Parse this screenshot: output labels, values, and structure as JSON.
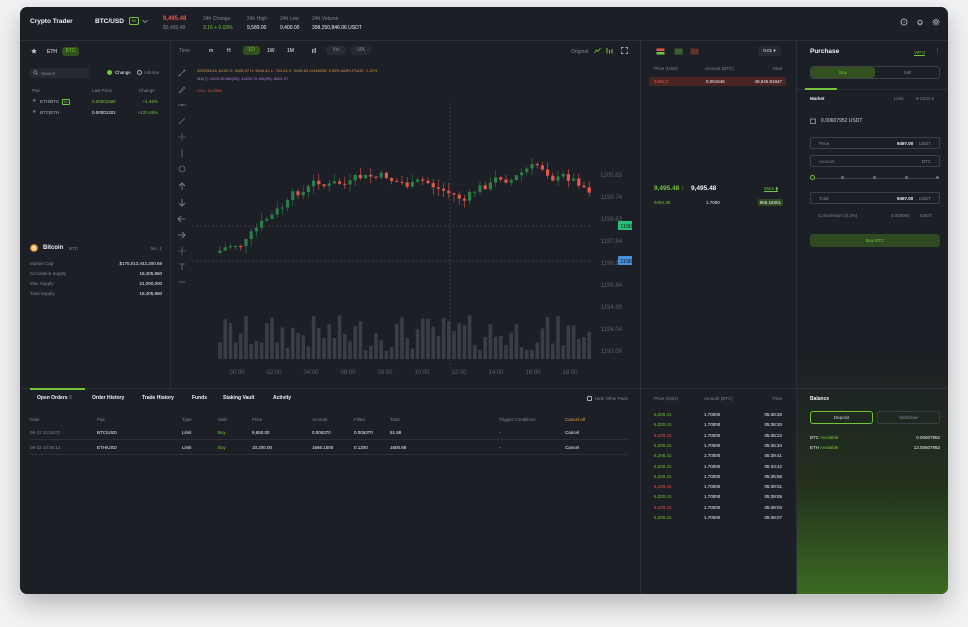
{
  "header": {
    "app_title": "Crypto Trader",
    "pair": "BTC/USD",
    "pair_badge": "5x",
    "last_price": "9,495.48",
    "last_price_usd": "$9,495.48",
    "stats": [
      {
        "label": "24h Change",
        "value": "3.16 + 0.03%"
      },
      {
        "label": "24h High",
        "value": "9,589.00"
      },
      {
        "label": "24h Low",
        "value": "9,400.00"
      },
      {
        "label": "24h Volume",
        "value": "398,250,846.06 USDT"
      }
    ]
  },
  "markets": {
    "tabs": [
      "ETH",
      "BTC"
    ],
    "search_placeholder": "Search",
    "toggle_change": "Change",
    "toggle_volume": "Volume",
    "columns": [
      "Pair",
      "Last Price",
      "Change"
    ],
    "rows": [
      {
        "pair": "ETH/BTC",
        "badge": "5x",
        "price": "0.00001586",
        "change": "+1.46%"
      },
      {
        "pair": "BTC/ETH",
        "badge": "",
        "price": "0.00001301",
        "change": "+120.45%"
      }
    ]
  },
  "coin": {
    "name": "Bitcoin",
    "ticker": "BTC",
    "rank": "No. 1",
    "info": [
      {
        "label": "Market Cap",
        "value": "$175,013,442,200.69"
      },
      {
        "label": "Circulation Supply",
        "value": "18,405,860"
      },
      {
        "label": "Max Supply",
        "value": "21,000,000"
      },
      {
        "label": "Total Supply",
        "value": "18,405,860"
      }
    ]
  },
  "chart": {
    "time_label": "Time",
    "intervals": [
      "m",
      "H",
      "1D",
      "1W",
      "1M"
    ],
    "active_interval": "1D",
    "indicators": [
      "Vol",
      "MA"
    ],
    "view_mode": "Original",
    "ohlc_line": "2020/06/16 18:00 O: 9425.97 H: 9534.42 L: 784.23 C: 9495.63 CHANGE: 0.05% AMPLITUDE: 1.22%",
    "ma_line": "MA(7): 9425.35 MA(25): 11455.72 MA(99): 8001.97",
    "vol_line": "VOL: 18.296K",
    "price_ticks": [
      "1200.85",
      "1199.74",
      "1198.63",
      "1197.84",
      "1196.95",
      "1195.84",
      "1194.89",
      "1194.04",
      "1193.09"
    ],
    "price_tag_green": "1196.63",
    "price_tag_blue": "1196.94",
    "time_ticks": [
      "00:00",
      "02:00",
      "04:00",
      "06:00",
      "08:00",
      "10:00",
      "12:00",
      "14:00",
      "16:00",
      "18:00"
    ]
  },
  "orderbook": {
    "precision": "0.01",
    "columns": [
      "Price (USD)",
      "Amount (BTC)",
      "Total"
    ],
    "asks": [
      {
        "price": "9495.3",
        "amount": "0.051645",
        "total": "49,945.91847"
      }
    ],
    "mid_price": "9,495.48",
    "mid_price_alt": "9,495.48",
    "more_label": "More",
    "bids": [
      {
        "price": "9494.36",
        "amount": "1.7000",
        "total": "966.16301"
      }
    ]
  },
  "trades": {
    "columns": [
      "Price (USD)",
      "Amount (BTC)",
      "Time"
    ],
    "rows": [
      {
        "price": "6,200.41",
        "amount": "1.70000",
        "time": "05:38:20",
        "side": "buy"
      },
      {
        "price": "6,200.41",
        "amount": "1.70000",
        "time": "05:38:20",
        "side": "buy"
      },
      {
        "price": "6,200.41",
        "amount": "1.70000",
        "time": "05:35:22",
        "side": "sell"
      },
      {
        "price": "6,200.41",
        "amount": "1.70000",
        "time": "05:35:34",
        "side": "buy"
      },
      {
        "price": "6,200.41",
        "amount": "1.70000",
        "time": "05:39:41",
        "side": "buy"
      },
      {
        "price": "6,200.41",
        "amount": "1.70000",
        "time": "05:33:42",
        "side": "buy"
      },
      {
        "price": "6,200.41",
        "amount": "1.70000",
        "time": "05:35:55",
        "side": "buy"
      },
      {
        "price": "6,200.41",
        "amount": "1.70000",
        "time": "05:39:01",
        "side": "sell"
      },
      {
        "price": "6,200.41",
        "amount": "1.70000",
        "time": "05:39:05",
        "side": "buy"
      },
      {
        "price": "6,200.41",
        "amount": "1.70000",
        "time": "05:39:03",
        "side": "sell"
      },
      {
        "price": "6,200.41",
        "amount": "1.70000",
        "time": "05:38:07",
        "side": "buy"
      }
    ]
  },
  "purchase": {
    "title": "Purchase",
    "vip": "VIP 0",
    "tabs": [
      "Buy",
      "Sell"
    ],
    "order_types": [
      "Market",
      "Limit",
      "OCO"
    ],
    "available": "0.00607952 USDT",
    "price_label": "Price",
    "price_value": "9497.00",
    "price_unit": "USDT",
    "amount_label": "Amount",
    "amount_unit": "BTC",
    "total_label": "Total",
    "total_value": "9497.00",
    "total_unit": "USDT",
    "commission_label": "Commission (0.2%)",
    "commission_value": "0.000004",
    "commission_unit": "USDT",
    "submit": "Buy BTC"
  },
  "orders": {
    "tabs": [
      "Open Orders",
      "Order History",
      "Trade History",
      "Funds",
      "Staking Vault",
      "Activity"
    ],
    "open_count": "0",
    "hide_pairs": "Hide Other Pairs",
    "columns": [
      "Date",
      "Pair",
      "Type",
      "Side",
      "Price",
      "Amount",
      "Filled",
      "Total",
      "Trigger Conditions",
      "Cancel All"
    ],
    "rows": [
      {
        "date": "06-22 10:26:07",
        "pair": "BTC/USD",
        "type": "Limit",
        "side": "Buy",
        "price": "9,650.00",
        "amount": "0.005370",
        "filled": "0.005370",
        "total": "51.88",
        "trigger": "-",
        "action": "Cancel"
      },
      {
        "date": "06-22 10:36:12",
        "pair": "ETH/USD",
        "type": "Limit",
        "side": "Buy",
        "price": "10,200.00",
        "amount": "1666.1500",
        "filled": "0.1200",
        "total": "1600.88",
        "trigger": "-",
        "action": "Cancel"
      }
    ]
  },
  "balance": {
    "title": "Balance",
    "deposit": "Deposit",
    "withdraw": "Withdraw",
    "rows": [
      {
        "asset": "BTC",
        "label": "Available",
        "value": "0.00607952"
      },
      {
        "asset": "ETH",
        "label": "Available",
        "value": "13.00607952"
      }
    ]
  },
  "colors": {
    "green": "#73c43a",
    "red": "#e2574c",
    "accent_bg": "#33501f",
    "panel": "#1c1f26"
  }
}
